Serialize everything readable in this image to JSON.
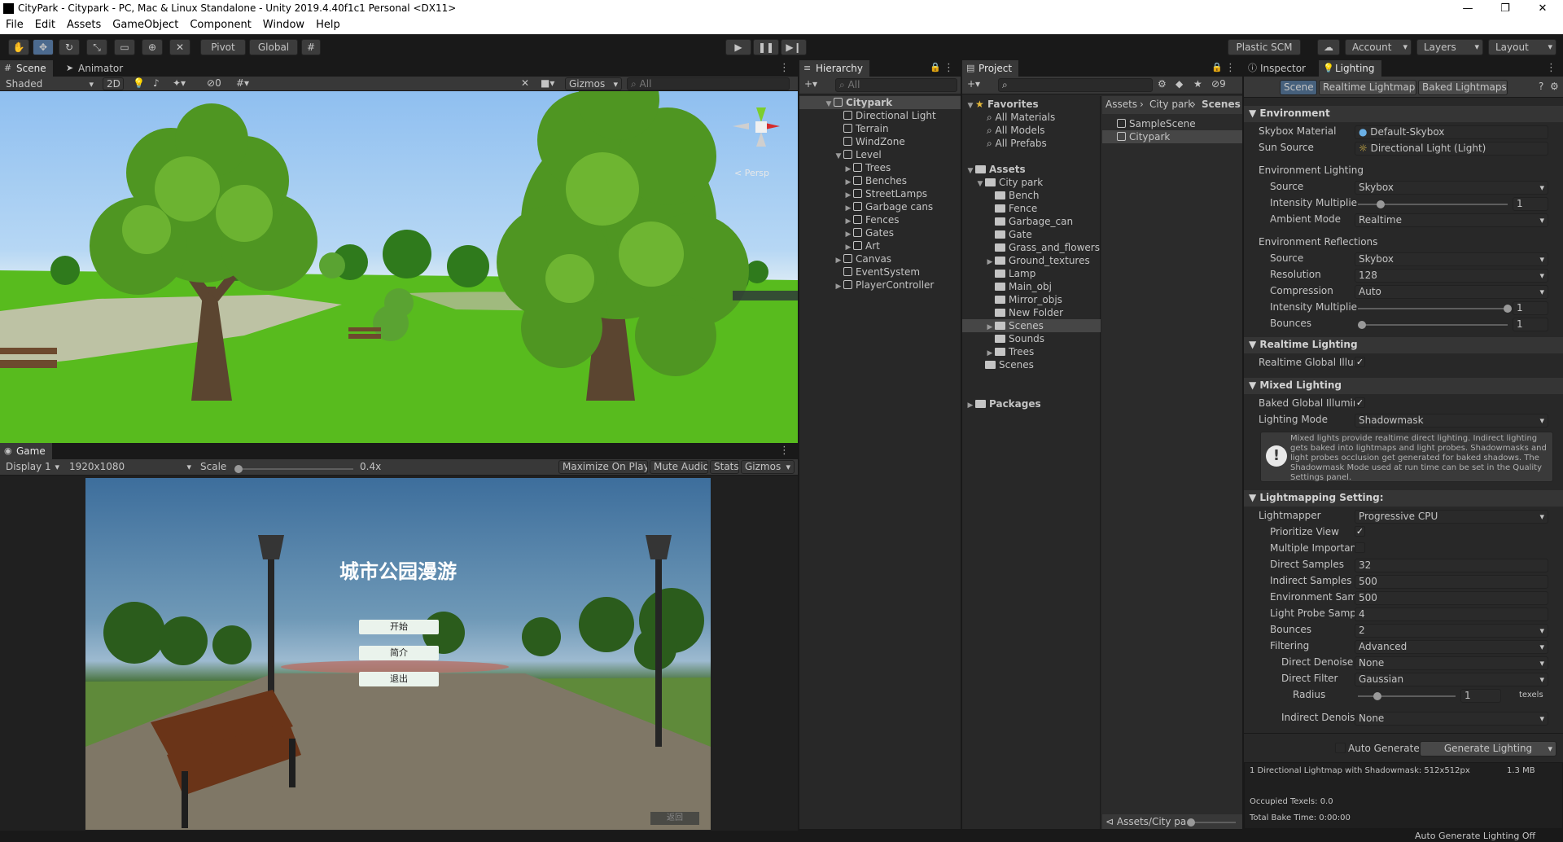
{
  "window": {
    "title": "CityPark - Citypark - PC, Mac & Linux Standalone - Unity 2019.4.40f1c1 Personal <DX11>",
    "controls": [
      "—",
      "❐",
      "✕"
    ]
  },
  "menu": [
    "File",
    "Edit",
    "Assets",
    "GameObject",
    "Component",
    "Window",
    "Help"
  ],
  "toolbar": {
    "pivot": "Pivot",
    "global": "Global",
    "plastic": "Plastic SCM",
    "account": "Account",
    "layers": "Layers",
    "layout": "Layout"
  },
  "scene": {
    "tab": "Scene",
    "tab2": "Animator",
    "shading": "Shaded",
    "mode2d": "2D",
    "hidden_count": "0",
    "gizmos": "Gizmos",
    "search_placeholder": "All",
    "persp": "< Persp"
  },
  "game": {
    "tab": "Game",
    "display": "Display 1",
    "resolution": "1920x1080",
    "scale_label": "Scale",
    "scale_value": "0.4x",
    "scale_fraction": 0.0,
    "maximize": "Maximize On Play",
    "mute": "Mute Audio",
    "stats": "Stats",
    "gizmos": "Gizmos",
    "ui_title": "城市公园漫游",
    "btn_start": "开始",
    "btn_intro": "简介",
    "btn_quit": "退出",
    "btn_back": "返回"
  },
  "hierarchy": {
    "tab": "Hierarchy",
    "search_placeholder": "All",
    "root": "Citypark",
    "items": [
      {
        "label": "Directional Light",
        "indent": 1,
        "fold": ""
      },
      {
        "label": "Terrain",
        "indent": 1,
        "fold": ""
      },
      {
        "label": "WindZone",
        "indent": 1,
        "fold": ""
      },
      {
        "label": "Level",
        "indent": 1,
        "fold": "▼"
      },
      {
        "label": "Trees",
        "indent": 2,
        "fold": "▶"
      },
      {
        "label": "Benches",
        "indent": 2,
        "fold": "▶"
      },
      {
        "label": "StreetLamps",
        "indent": 2,
        "fold": "▶"
      },
      {
        "label": "Garbage cans",
        "indent": 2,
        "fold": "▶"
      },
      {
        "label": "Fences",
        "indent": 2,
        "fold": "▶"
      },
      {
        "label": "Gates",
        "indent": 2,
        "fold": "▶"
      },
      {
        "label": "Art",
        "indent": 2,
        "fold": "▶"
      },
      {
        "label": "Canvas",
        "indent": 1,
        "fold": "▶"
      },
      {
        "label": "EventSystem",
        "indent": 1,
        "fold": ""
      },
      {
        "label": "PlayerController",
        "indent": 1,
        "fold": "▶"
      }
    ]
  },
  "project": {
    "tab": "Project",
    "hidden_count": "9",
    "favorites": "Favorites",
    "fav_items": [
      "All Materials",
      "All Models",
      "All Prefabs"
    ],
    "assets": "Assets",
    "tree": [
      {
        "label": "City park",
        "indent": 1,
        "fold": "▼"
      },
      {
        "label": "Bench",
        "indent": 2,
        "fold": ""
      },
      {
        "label": "Fence",
        "indent": 2,
        "fold": ""
      },
      {
        "label": "Garbage_can",
        "indent": 2,
        "fold": ""
      },
      {
        "label": "Gate",
        "indent": 2,
        "fold": ""
      },
      {
        "label": "Grass_and_flowers",
        "indent": 2,
        "fold": ""
      },
      {
        "label": "Ground_textures",
        "indent": 2,
        "fold": "▶"
      },
      {
        "label": "Lamp",
        "indent": 2,
        "fold": ""
      },
      {
        "label": "Main_obj",
        "indent": 2,
        "fold": ""
      },
      {
        "label": "Mirror_objs",
        "indent": 2,
        "fold": ""
      },
      {
        "label": "New Folder",
        "indent": 2,
        "fold": ""
      },
      {
        "label": "Scenes",
        "indent": 2,
        "fold": "▶"
      },
      {
        "label": "Sounds",
        "indent": 2,
        "fold": ""
      },
      {
        "label": "Trees",
        "indent": 2,
        "fold": "▶"
      },
      {
        "label": "Scenes",
        "indent": 1,
        "fold": ""
      }
    ],
    "packages": "Packages",
    "breadcrumb": [
      "Assets",
      "City park",
      "Scenes"
    ],
    "files": [
      "SampleScene",
      "Citypark"
    ],
    "footer_path": "Assets/City pa"
  },
  "inspector": {
    "tab": "Inspector",
    "tab2": "Lighting",
    "subtabs": [
      "Scene",
      "Realtime Lightmaps",
      "Baked Lightmaps"
    ],
    "environment": {
      "header": "Environment",
      "skybox_label": "Skybox Material",
      "skybox_value": "Default-Skybox",
      "sun_label": "Sun Source",
      "sun_value": "Directional Light (Light)",
      "env_lighting": "Environment Lighting",
      "source_label": "Source",
      "source_value": "Skybox",
      "intensity_label": "Intensity Multiplie",
      "intensity_value": "1",
      "intensity_fraction": 0.15,
      "ambient_label": "Ambient Mode",
      "ambient_value": "Realtime",
      "env_reflections": "Environment Reflections",
      "refl_source_value": "Skybox",
      "resolution_label": "Resolution",
      "resolution_value": "128",
      "compression_label": "Compression",
      "compression_value": "Auto",
      "refl_intensity_value": "1",
      "refl_intensity_fraction": 1.0,
      "bounces_label": "Bounces",
      "bounces_value": "1",
      "bounces_fraction": 0.0
    },
    "realtime": {
      "header": "Realtime Lighting",
      "gi_label": "Realtime Global Illun"
    },
    "mixed": {
      "header": "Mixed Lighting",
      "baked_label": "Baked Global Illumin",
      "mode_label": "Lighting Mode",
      "mode_value": "Shadowmask",
      "help": "Mixed lights provide realtime direct lighting. Indirect lighting gets baked into lightmaps and light probes. Shadowmasks and light probes occlusion get generated for baked shadows. The Shadowmask Mode used at run time can be set in the Quality Settings panel."
    },
    "lightmapping": {
      "header": "Lightmapping Setting:",
      "lightmapper_label": "Lightmapper",
      "lightmapper_value": "Progressive CPU",
      "prioritize_label": "Prioritize View",
      "mis_label": "Multiple Importanc",
      "direct_label": "Direct Samples",
      "direct_value": "32",
      "indirect_label": "Indirect Samples",
      "indirect_value": "500",
      "env_label": "Environment Sam",
      "env_value": "500",
      "probe_label": "Light Probe Samp",
      "probe_value": "4",
      "bounces_label": "Bounces",
      "bounces_value": "2",
      "filtering_label": "Filtering",
      "filtering_value": "Advanced",
      "denoiser_label": "Direct Denoise",
      "denoiser_value": "None",
      "filter_label": "Direct Filter",
      "filter_value": "Gaussian",
      "radius_label": "Radius",
      "radius_value": "1",
      "radius_unit": "texels",
      "radius_fraction": 0.2,
      "indirect_denoiser_label": "Indirect Denois",
      "indirect_denoiser_value": "None"
    },
    "auto_generate": "Auto Generate",
    "generate": "Generate Lighting",
    "stats": {
      "line1": "1 Directional Lightmap with Shadowmask: 512x512px",
      "size": "1.3 MB",
      "occupied": "Occupied Texels: 0.0",
      "bake_time": "Total Bake Time: 0:00:00"
    }
  },
  "statusbar": {
    "right": "Auto Generate Lighting Off"
  },
  "colors": {
    "selection": "#2c5d87",
    "panel": "#282828",
    "header": "#383838"
  }
}
